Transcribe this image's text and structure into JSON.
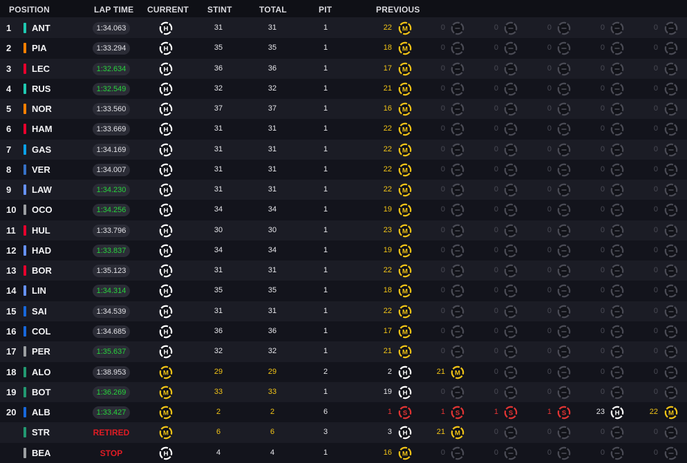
{
  "header": {
    "position": "POSITION",
    "lap_time": "LAP TIME",
    "current": "CURRENT",
    "stint": "STINT",
    "total": "TOTAL",
    "pit": "PIT",
    "previous": "PREVIOUS"
  },
  "colors": {
    "fastest": "#27d33c",
    "retired": "#e01c24",
    "medium": "#f2c416",
    "hard": "#ffffff",
    "soft": "#e23434",
    "empty": "#4a4b55"
  },
  "rows": [
    {
      "pos": "1",
      "team_color": "#1fc9b1",
      "driver": "ANT",
      "lap": "1:34.063",
      "lap_fast": false,
      "current": "H",
      "stint": "31",
      "total": "31",
      "pit": "1",
      "prev": [
        [
          "22",
          "M"
        ],
        [
          "0",
          ""
        ],
        [
          "0",
          ""
        ],
        [
          "0",
          ""
        ],
        [
          "0",
          ""
        ],
        [
          "0",
          ""
        ]
      ]
    },
    {
      "pos": "2",
      "team_color": "#ff8000",
      "driver": "PIA",
      "lap": "1:33.294",
      "lap_fast": false,
      "current": "H",
      "stint": "35",
      "total": "35",
      "pit": "1",
      "prev": [
        [
          "18",
          "M"
        ],
        [
          "0",
          ""
        ],
        [
          "0",
          ""
        ],
        [
          "0",
          ""
        ],
        [
          "0",
          ""
        ],
        [
          "0",
          ""
        ]
      ]
    },
    {
      "pos": "3",
      "team_color": "#e8002d",
      "driver": "LEC",
      "lap": "1:32.634",
      "lap_fast": true,
      "current": "H",
      "stint": "36",
      "total": "36",
      "pit": "1",
      "prev": [
        [
          "17",
          "M"
        ],
        [
          "0",
          ""
        ],
        [
          "0",
          ""
        ],
        [
          "0",
          ""
        ],
        [
          "0",
          ""
        ],
        [
          "0",
          ""
        ]
      ]
    },
    {
      "pos": "4",
      "team_color": "#1fc9b1",
      "driver": "RUS",
      "lap": "1:32.549",
      "lap_fast": true,
      "current": "H",
      "stint": "32",
      "total": "32",
      "pit": "1",
      "prev": [
        [
          "21",
          "M"
        ],
        [
          "0",
          ""
        ],
        [
          "0",
          ""
        ],
        [
          "0",
          ""
        ],
        [
          "0",
          ""
        ],
        [
          "0",
          ""
        ]
      ]
    },
    {
      "pos": "5",
      "team_color": "#ff8000",
      "driver": "NOR",
      "lap": "1:33.560",
      "lap_fast": false,
      "current": "H",
      "stint": "37",
      "total": "37",
      "pit": "1",
      "prev": [
        [
          "16",
          "M"
        ],
        [
          "0",
          ""
        ],
        [
          "0",
          ""
        ],
        [
          "0",
          ""
        ],
        [
          "0",
          ""
        ],
        [
          "0",
          ""
        ]
      ]
    },
    {
      "pos": "6",
      "team_color": "#e8002d",
      "driver": "HAM",
      "lap": "1:33.669",
      "lap_fast": false,
      "current": "H",
      "stint": "31",
      "total": "31",
      "pit": "1",
      "prev": [
        [
          "22",
          "M"
        ],
        [
          "0",
          ""
        ],
        [
          "0",
          ""
        ],
        [
          "0",
          ""
        ],
        [
          "0",
          ""
        ],
        [
          "0",
          ""
        ]
      ]
    },
    {
      "pos": "7",
      "team_color": "#0ba1e8",
      "driver": "GAS",
      "lap": "1:34.169",
      "lap_fast": false,
      "current": "H",
      "stint": "31",
      "total": "31",
      "pit": "1",
      "prev": [
        [
          "22",
          "M"
        ],
        [
          "0",
          ""
        ],
        [
          "0",
          ""
        ],
        [
          "0",
          ""
        ],
        [
          "0",
          ""
        ],
        [
          "0",
          ""
        ]
      ]
    },
    {
      "pos": "8",
      "team_color": "#3671c6",
      "driver": "VER",
      "lap": "1:34.007",
      "lap_fast": false,
      "current": "H",
      "stint": "31",
      "total": "31",
      "pit": "1",
      "prev": [
        [
          "22",
          "M"
        ],
        [
          "0",
          ""
        ],
        [
          "0",
          ""
        ],
        [
          "0",
          ""
        ],
        [
          "0",
          ""
        ],
        [
          "0",
          ""
        ]
      ]
    },
    {
      "pos": "9",
      "team_color": "#6692ff",
      "driver": "LAW",
      "lap": "1:34.230",
      "lap_fast": true,
      "current": "H",
      "stint": "31",
      "total": "31",
      "pit": "1",
      "prev": [
        [
          "22",
          "M"
        ],
        [
          "0",
          ""
        ],
        [
          "0",
          ""
        ],
        [
          "0",
          ""
        ],
        [
          "0",
          ""
        ],
        [
          "0",
          ""
        ]
      ]
    },
    {
      "pos": "10",
      "team_color": "#9c9fa2",
      "driver": "OCO",
      "lap": "1:34.256",
      "lap_fast": true,
      "current": "H",
      "stint": "34",
      "total": "34",
      "pit": "1",
      "prev": [
        [
          "19",
          "M"
        ],
        [
          "0",
          ""
        ],
        [
          "0",
          ""
        ],
        [
          "0",
          ""
        ],
        [
          "0",
          ""
        ],
        [
          "0",
          ""
        ]
      ]
    },
    {
      "pos": "11",
      "team_color": "#e8002d",
      "driver": "HUL",
      "lap": "1:33.796",
      "lap_fast": false,
      "current": "H",
      "stint": "30",
      "total": "30",
      "pit": "1",
      "prev": [
        [
          "23",
          "M"
        ],
        [
          "0",
          ""
        ],
        [
          "0",
          ""
        ],
        [
          "0",
          ""
        ],
        [
          "0",
          ""
        ],
        [
          "0",
          ""
        ]
      ]
    },
    {
      "pos": "12",
      "team_color": "#6692ff",
      "driver": "HAD",
      "lap": "1:33.837",
      "lap_fast": true,
      "current": "H",
      "stint": "34",
      "total": "34",
      "pit": "1",
      "prev": [
        [
          "19",
          "M"
        ],
        [
          "0",
          ""
        ],
        [
          "0",
          ""
        ],
        [
          "0",
          ""
        ],
        [
          "0",
          ""
        ],
        [
          "0",
          ""
        ]
      ]
    },
    {
      "pos": "13",
      "team_color": "#e8002d",
      "driver": "BOR",
      "lap": "1:35.123",
      "lap_fast": false,
      "current": "H",
      "stint": "31",
      "total": "31",
      "pit": "1",
      "prev": [
        [
          "22",
          "M"
        ],
        [
          "0",
          ""
        ],
        [
          "0",
          ""
        ],
        [
          "0",
          ""
        ],
        [
          "0",
          ""
        ],
        [
          "0",
          ""
        ]
      ]
    },
    {
      "pos": "14",
      "team_color": "#6692ff",
      "driver": "LIN",
      "lap": "1:34.314",
      "lap_fast": true,
      "current": "H",
      "stint": "35",
      "total": "35",
      "pit": "1",
      "prev": [
        [
          "18",
          "M"
        ],
        [
          "0",
          ""
        ],
        [
          "0",
          ""
        ],
        [
          "0",
          ""
        ],
        [
          "0",
          ""
        ],
        [
          "0",
          ""
        ]
      ]
    },
    {
      "pos": "15",
      "team_color": "#1868db",
      "driver": "SAI",
      "lap": "1:34.539",
      "lap_fast": false,
      "current": "H",
      "stint": "31",
      "total": "31",
      "pit": "1",
      "prev": [
        [
          "22",
          "M"
        ],
        [
          "0",
          ""
        ],
        [
          "0",
          ""
        ],
        [
          "0",
          ""
        ],
        [
          "0",
          ""
        ],
        [
          "0",
          ""
        ]
      ]
    },
    {
      "pos": "16",
      "team_color": "#1868db",
      "driver": "COL",
      "lap": "1:34.685",
      "lap_fast": false,
      "current": "H",
      "stint": "36",
      "total": "36",
      "pit": "1",
      "prev": [
        [
          "17",
          "M"
        ],
        [
          "0",
          ""
        ],
        [
          "0",
          ""
        ],
        [
          "0",
          ""
        ],
        [
          "0",
          ""
        ],
        [
          "0",
          ""
        ]
      ]
    },
    {
      "pos": "17",
      "team_color": "#9c9fa2",
      "driver": "PER",
      "lap": "1:35.637",
      "lap_fast": true,
      "current": "H",
      "stint": "32",
      "total": "32",
      "pit": "1",
      "prev": [
        [
          "21",
          "M"
        ],
        [
          "0",
          ""
        ],
        [
          "0",
          ""
        ],
        [
          "0",
          ""
        ],
        [
          "0",
          ""
        ],
        [
          "0",
          ""
        ]
      ]
    },
    {
      "pos": "18",
      "team_color": "#229971",
      "driver": "ALO",
      "lap": "1:38.953",
      "lap_fast": false,
      "current": "M",
      "stint": "29",
      "total": "29",
      "pit": "2",
      "prev": [
        [
          "2",
          "H"
        ],
        [
          "21",
          "M"
        ],
        [
          "0",
          ""
        ],
        [
          "0",
          ""
        ],
        [
          "0",
          ""
        ],
        [
          "0",
          ""
        ]
      ]
    },
    {
      "pos": "19",
      "team_color": "#229971",
      "driver": "BOT",
      "lap": "1:36.269",
      "lap_fast": true,
      "current": "M",
      "stint": "33",
      "total": "33",
      "pit": "1",
      "prev": [
        [
          "19",
          "H"
        ],
        [
          "0",
          ""
        ],
        [
          "0",
          ""
        ],
        [
          "0",
          ""
        ],
        [
          "0",
          ""
        ],
        [
          "0",
          ""
        ]
      ]
    },
    {
      "pos": "20",
      "team_color": "#1868db",
      "driver": "ALB",
      "lap": "1:33.427",
      "lap_fast": true,
      "current": "M",
      "stint": "2",
      "total": "2",
      "pit": "6",
      "prev": [
        [
          "1",
          "S"
        ],
        [
          "1",
          "S"
        ],
        [
          "1",
          "S"
        ],
        [
          "1",
          "S"
        ],
        [
          "23",
          "H"
        ],
        [
          "22",
          "M"
        ]
      ]
    },
    {
      "pos": "",
      "team_color": "#229971",
      "driver": "STR",
      "lap": "RETIRED",
      "lap_status": true,
      "current": "M",
      "stint": "6",
      "total": "6",
      "pit": "3",
      "prev": [
        [
          "3",
          "H"
        ],
        [
          "21",
          "M"
        ],
        [
          "0",
          ""
        ],
        [
          "0",
          ""
        ],
        [
          "0",
          ""
        ],
        [
          "0",
          ""
        ]
      ]
    },
    {
      "pos": "",
      "team_color": "#9c9fa2",
      "driver": "BEA",
      "lap": "STOP",
      "lap_status": true,
      "current": "H",
      "stint": "4",
      "total": "4",
      "pit": "1",
      "prev": [
        [
          "16",
          "M"
        ],
        [
          "0",
          ""
        ],
        [
          "0",
          ""
        ],
        [
          "0",
          ""
        ],
        [
          "0",
          ""
        ],
        [
          "0",
          ""
        ]
      ]
    }
  ]
}
